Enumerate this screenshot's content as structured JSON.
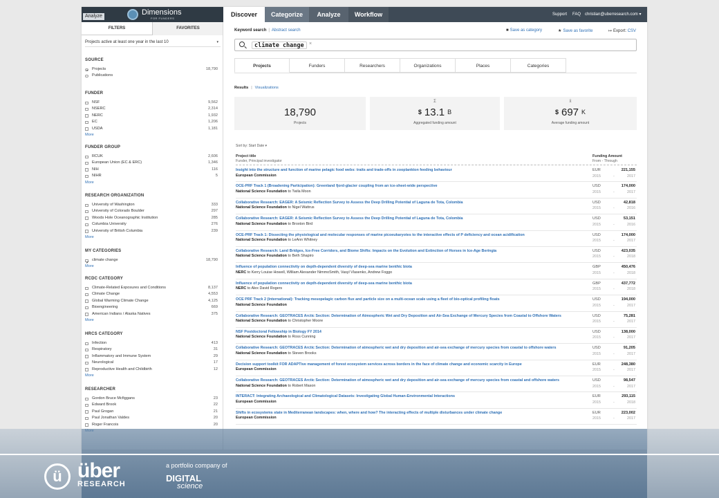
{
  "header": {
    "analyze_chip": "Analyze",
    "logo_text": "Dimensions",
    "logo_sub": "FOR FUNDERS",
    "tabs": [
      {
        "label": "Discover"
      },
      {
        "label": "Categorize"
      },
      {
        "label": "Analyze"
      },
      {
        "label": "Workflow"
      }
    ],
    "links": {
      "support": "Support",
      "faq": "FAQ",
      "user": "christian@uberresearch.com ▾"
    }
  },
  "filters": {
    "tabs": [
      "FILTERS",
      "FAVORITES"
    ],
    "period": "Projects active at least one year in the last 10",
    "sections": [
      {
        "title": "SOURCE",
        "type": "radio",
        "items": [
          {
            "label": "Projects",
            "count": "18,790",
            "checked": true
          },
          {
            "label": "Publications",
            "count": "",
            "checked": false
          }
        ],
        "more": ""
      },
      {
        "title": "FUNDER",
        "type": "check",
        "items": [
          {
            "label": "NSF",
            "count": "9,562"
          },
          {
            "label": "NSERC",
            "count": "2,314"
          },
          {
            "label": "NERC",
            "count": "1,932"
          },
          {
            "label": "EC",
            "count": "1,206"
          },
          {
            "label": "USDA",
            "count": "1,181"
          }
        ],
        "more": "More"
      },
      {
        "title": "FUNDER GROUP",
        "type": "check",
        "items": [
          {
            "label": "RCUK",
            "count": "2,606"
          },
          {
            "label": "European Union (EC & ERC)",
            "count": "1,346"
          },
          {
            "label": "NIH",
            "count": "116"
          },
          {
            "label": "NIHR",
            "count": "5"
          }
        ],
        "more": "More"
      },
      {
        "title": "RESEARCH ORGANIZATION",
        "type": "check",
        "items": [
          {
            "label": "University of Washington",
            "count": "333"
          },
          {
            "label": "University of Colorado Boulder",
            "count": "297"
          },
          {
            "label": "Woods Hole Oceanographic Institution",
            "count": "285"
          },
          {
            "label": "Columbia University",
            "count": "276"
          },
          {
            "label": "University of British Columbia",
            "count": "239"
          }
        ],
        "more": "More"
      },
      {
        "title": "MY CATEGORIES",
        "type": "check",
        "items": [
          {
            "label": "climate change",
            "count": "18,790",
            "checked": true
          }
        ],
        "more": "More"
      },
      {
        "title": "RCDC CATEGORY",
        "type": "check",
        "items": [
          {
            "label": "Climate-Related Exposures and Conditions",
            "count": "8,137"
          },
          {
            "label": "Climate Change",
            "count": "4,553"
          },
          {
            "label": "Global Warming Climate Change",
            "count": "4,125"
          },
          {
            "label": "Bioengineering",
            "count": "669"
          },
          {
            "label": "American Indians / Alaska Natives",
            "count": "375"
          }
        ],
        "more": "More"
      },
      {
        "title": "HRCS CATEGORY",
        "type": "check",
        "items": [
          {
            "label": "Infection",
            "count": "413"
          },
          {
            "label": "Respiratory",
            "count": "31"
          },
          {
            "label": "Inflammatory and Immune System",
            "count": "29"
          },
          {
            "label": "Neurological",
            "count": "17"
          },
          {
            "label": "Reproductive Health and Childbirth",
            "count": "12"
          }
        ],
        "more": "More"
      },
      {
        "title": "RESEARCHER",
        "type": "check",
        "items": [
          {
            "label": "Gordon Bruce Mcfiggans",
            "count": "23"
          },
          {
            "label": "Edward Brook",
            "count": "22"
          },
          {
            "label": "Paul Grogan",
            "count": "21"
          },
          {
            "label": "Paul Jonathan Valdes",
            "count": "20"
          },
          {
            "label": "Roger Francois",
            "count": "20"
          }
        ],
        "more": "More"
      }
    ]
  },
  "main": {
    "search_modes": {
      "keyword": "Keyword search",
      "abstract": "Abstract search"
    },
    "actions": {
      "save_category": "Save as category",
      "save_favorite": "Save as favorite",
      "export_label": "Export:",
      "export_fmt": "CSV"
    },
    "query": "climate change",
    "result_tabs": [
      "Projects",
      "Funders",
      "Researchers",
      "Organizations",
      "Places",
      "Categories"
    ],
    "sub_tabs": {
      "results": "Results",
      "visualizations": "Visualizations"
    },
    "stats": [
      {
        "symbol": "",
        "currency": "",
        "value": "18,790",
        "unit": "",
        "caption": "Projects"
      },
      {
        "symbol": "Σ",
        "currency": "$",
        "value": "13.1",
        "unit": "B",
        "caption": "Aggregated funding amount"
      },
      {
        "symbol": "x̄",
        "currency": "$",
        "value": "697",
        "unit": "K",
        "caption": "Average funding amount"
      }
    ],
    "sort_by": "Sort by: Start Date ▾",
    "columns": {
      "title": "Project title",
      "title_sub": "Funder, Principal investigator",
      "funding": "Funding Amount",
      "funding_sub": "From - Through"
    },
    "rows": [
      {
        "title": "Insight into the structure and function of marine pelagic food webs: traits and trade-offs in zooplankton feeding behaviour",
        "funder": "European Commission",
        "pi": "",
        "currency": "EUR",
        "amount": "221,155",
        "from": "2015",
        "to": "2017"
      },
      {
        "title": "OCE-PRF Track 1 (Broadening Participation): Greenland fjord-glacier coupling from an ice-sheet-wide perspective",
        "funder": "National Science Foundation",
        "pi": "to Twila Moon",
        "currency": "USD",
        "amount": "174,000",
        "from": "2015",
        "to": "2017"
      },
      {
        "title": "Collaborative Research: EAGER: A Seismic Reflection Survey to Assess the Deep Drilling Potential of Laguna de Tota, Colombia",
        "funder": "National Science Foundation",
        "pi": "to Nigel Wattrus",
        "currency": "USD",
        "amount": "42,818",
        "from": "2015",
        "to": "2016"
      },
      {
        "title": "Collaborative Research: EAGER: A Seismic Reflection Survey to Assess the Deep Drilling Potential of Laguna de Tota, Colombia",
        "funder": "National Science Foundation",
        "pi": "to Broxton Bird",
        "currency": "USD",
        "amount": "53,151",
        "from": "2015",
        "to": "2016"
      },
      {
        "title": "OCE-PRF Track 1: Dissecting the physiological and molecular responses of marine picoeukaryotes to the interactive effects of P deficiency and ocean acidification",
        "funder": "National Science Foundation",
        "pi": "to LeAnn Whitney",
        "currency": "USD",
        "amount": "174,000",
        "from": "2015",
        "to": "2017"
      },
      {
        "title": "Collaborative Research: Land Bridges, Ice-Free Corridors, and Biome Shifts: Impacts on the Evolution and Extinction of Horses in Ice-Age Beringia",
        "funder": "National Science Foundation",
        "pi": "to Beth Shapiro",
        "currency": "USD",
        "amount": "423,035",
        "from": "2015",
        "to": "2018"
      },
      {
        "title": "Influence of population connectivity on depth-dependent diversity of deep-sea marine benthic biota",
        "funder": "NERC",
        "pi": "to Kerry Louise Howell, William Alexander NimmoSmith, Vasyl Vlasenko, Andrew Foggo",
        "currency": "GBP",
        "amount": "450,476",
        "from": "2015",
        "to": "2018"
      },
      {
        "title": "Influence of population connectivity on depth-dependent diversity of deep-sea marine benthic biota",
        "funder": "NERC",
        "pi": "to Alex David Rogers",
        "currency": "GBP",
        "amount": "437,772",
        "from": "2015",
        "to": "2018"
      },
      {
        "title": "OCE PRF Track 2 (International): Tracking mesopelagic carbon flux and particle size on a multi-ocean scale using a fleet of bio-optical profiling floats",
        "funder": "National Science Foundation",
        "pi": "",
        "currency": "USD",
        "amount": "194,000",
        "from": "2015",
        "to": "2017"
      },
      {
        "title": "Collaborative Research: GEOTRACES Arctic Section: Determination of Atmospheric Wet and Dry Deposition and Air-Sea Exchange of Mercury Species from Coastal to Offshore Waters",
        "funder": "National Science Foundation",
        "pi": "to Christopher Moore",
        "currency": "USD",
        "amount": "75,281",
        "from": "2015",
        "to": "2017"
      },
      {
        "title": "NSF Postdoctoral Fellowship in Biology FY 2014",
        "funder": "National Science Foundation",
        "pi": "to Ross Cunning",
        "currency": "USD",
        "amount": "138,000",
        "from": "2015",
        "to": "2017"
      },
      {
        "title": "Collaborative Research: GEOTRACES Arctic Section: Determination of atmospheric wet and dry deposition and air-sea exchange of mercury species from coastal to offshore waters",
        "funder": "National Science Foundation",
        "pi": "to Steven Brooks",
        "currency": "USD",
        "amount": "91,205",
        "from": "2015",
        "to": "2017"
      },
      {
        "title": "Decision support toolkit FOR ADAPTive management of forest ecosystem services across borders in the face of climate change and economic scarcity in Europe",
        "funder": "European Commission",
        "pi": "",
        "currency": "EUR",
        "amount": "248,380",
        "from": "2015",
        "to": "2017"
      },
      {
        "title": "Collaborative Research: GEOTRACES Arctic Section: Determination of atmospheric wet and dry deposition and air-sea exchange of mercury species from coastal and offshore waters",
        "funder": "National Science Foundation",
        "pi": "to Robert Mason",
        "currency": "USD",
        "amount": "98,547",
        "from": "2015",
        "to": "2017"
      },
      {
        "title": "INTERACT: Integrating Archaeological and Climatological Datasets: Investigating Global Human-Environmental Interactions",
        "funder": "European Commission",
        "pi": "",
        "currency": "EUR",
        "amount": "293,115",
        "from": "2015",
        "to": "2018"
      },
      {
        "title": "Shifts in ecosystems state in Mediterranean landscapes: when, where and how? The interacting effects of multiple disturbances under climate change",
        "funder": "European Commission",
        "pi": "",
        "currency": "EUR",
        "amount": "223,002",
        "from": "2015",
        "to": "2017"
      }
    ]
  },
  "footer": {
    "company": "über",
    "company_sub": "RESEARCH",
    "portfolio": "a portfolio company of",
    "parent": "DIGITAL",
    "parent_sub": "science"
  },
  "colors": {
    "nav": "#3e4a56",
    "link": "#2d6fb5",
    "stat_bg": "#f3f3f3"
  }
}
